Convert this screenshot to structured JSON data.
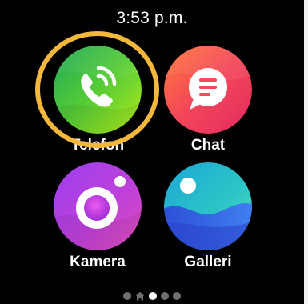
{
  "status_bar": {
    "time": "3:53 p.m."
  },
  "apps": [
    {
      "label": "Telefon",
      "icon": "phone-icon",
      "focused": true
    },
    {
      "label": "Chat",
      "icon": "chat-icon",
      "focused": false
    },
    {
      "label": "Kamera",
      "icon": "camera-icon",
      "focused": false
    },
    {
      "label": "Galleri",
      "icon": "gallery-icon",
      "focused": false
    }
  ],
  "page_indicator": {
    "pages": 5,
    "home_page": 2,
    "current_page": 3
  },
  "colors": {
    "background": "#000000",
    "focus_ring": "#f6b83b",
    "telefon": "#4cc83a",
    "chat": "#f2445a",
    "kamera": "#b540d8",
    "galleri": "#2ec6c6"
  }
}
